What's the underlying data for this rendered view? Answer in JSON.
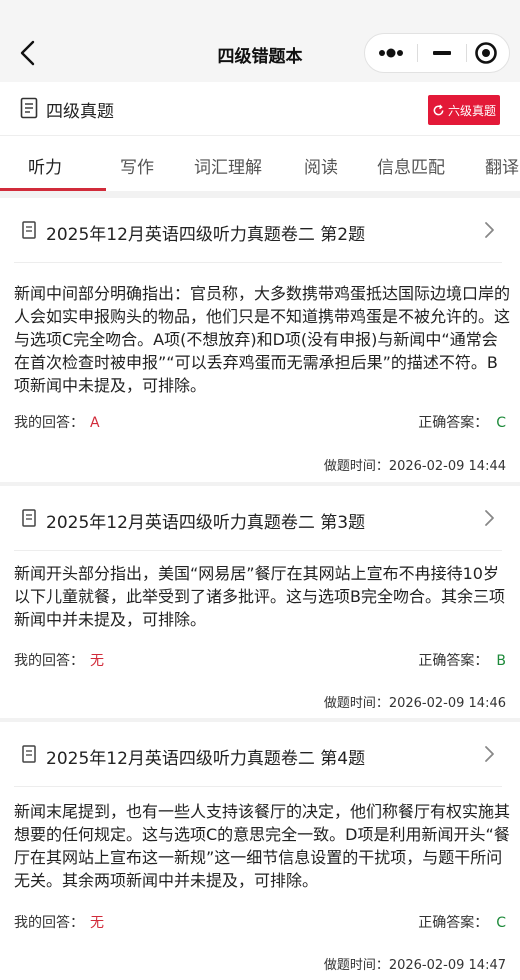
{
  "navbar": {
    "title": "四级错题本",
    "back_icon": "chevron-left-icon",
    "menu_icon": "more-dots-icon",
    "minimize_icon": "minus-icon",
    "close_icon": "target-circle-icon"
  },
  "subheader": {
    "title": "四级真题",
    "switch_label": "六级真题",
    "accent": "#e31938"
  },
  "tabs": [
    "听力",
    "写作",
    "词汇理解",
    "阅读",
    "信息匹配",
    "翻译"
  ],
  "active_tab": 0,
  "labels": {
    "my_answer": "我的回答：",
    "correct_answer": "正确答案：",
    "time_prefix": "做题时间："
  },
  "colors": {
    "wrong": "#d12b3a",
    "right": "#1d8a3a"
  },
  "cards": [
    {
      "title": "2025年12月英语四级听力真题卷二 第2题",
      "explanation": "新闻中间部分明确指出：官员称，大多数携带鸡蛋抵达国际边境口岸的人会如实申报购头的物品，他们只是不知道携带鸡蛋是不被允许的。这与选项C完全吻合。A项(不想放弃)和D项(没有申报)与新闻中“通常会在首次检查时被申报”“可以丢弃鸡蛋而无需承担后果”的描述不符。B项新闻中未提及，可排除。",
      "my_answer": "A",
      "correct_answer": "C",
      "time": "2026-02-09 14:44"
    },
    {
      "title": "2025年12月英语四级听力真题卷二 第3题",
      "explanation": "新闻开头部分指出，美国“网易居”餐厅在其网站上宣布不冉接待10岁以下儿童就餐，此举受到了诸多批评。这与选项B完全吻合。其余三项新闻中并未提及，可排除。",
      "my_answer": "无",
      "correct_answer": "B",
      "time": "2026-02-09 14:46"
    },
    {
      "title": "2025年12月英语四级听力真题卷二 第4题",
      "explanation": "新闻末尾提到，也有一些人支持该餐厅的决定，他们称餐厅有权实施其想要的任何规定。这与选项C的意思完全一致。D项是利用新闻开头“餐厅在其网站上宣布这一新规”这一细节信息设置的干扰项，与题干所问无关。其余两项新闻中并未提及，可排除。",
      "my_answer": "无",
      "correct_answer": "C",
      "time": "2026-02-09 14:47"
    }
  ]
}
